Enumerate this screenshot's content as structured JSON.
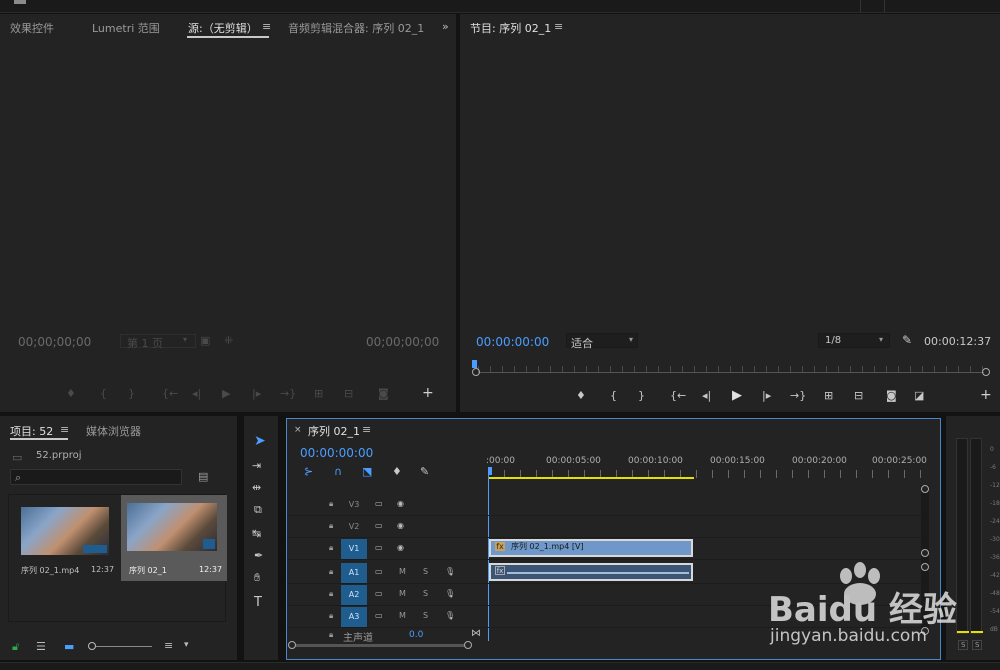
{
  "top_tabs": {
    "effect_controls": "效果控件",
    "lumetri": "Lumetri 范围",
    "source": "源:（无剪辑）",
    "audio_mixer": "音频剪辑混合器: 序列 02_1",
    "program": "节目: 序列 02_1"
  },
  "source_monitor": {
    "timecode_left": "00;00;00;00",
    "page": "第 1 页",
    "timecode_right": "00;00;00;00"
  },
  "program_monitor": {
    "timecode": "00:00:00:00",
    "fit": "适合",
    "resolution": "1/8",
    "duration": "00:00:12:37"
  },
  "project": {
    "tab": "项目: 52",
    "media_browser": "媒体浏览器",
    "file": "52.prproj",
    "items": [
      {
        "name": "序列 02_1.mp4",
        "duration": "12:37"
      },
      {
        "name": "序列 02_1",
        "duration": "12:37"
      }
    ]
  },
  "timeline": {
    "tab": "序列 02_1",
    "timecode": "00:00:00:00",
    "ruler": [
      ":00:00",
      "00:00:05:00",
      "00:00:10:00",
      "00:00:15:00",
      "00:00:20:00",
      "00:00:25:00"
    ],
    "tracks": {
      "v3": "V3",
      "v2": "V2",
      "v1": "V1",
      "a1": "A1",
      "a2": "A2",
      "a3": "A3",
      "m": "M",
      "s": "S",
      "master": "主声道",
      "master_val": "0.0"
    },
    "clip_video": "序列 02_1.mp4 [V]"
  },
  "meter": {
    "labels": [
      "0",
      "-6",
      "-12",
      "-18",
      "-24",
      "-30",
      "-36",
      "-42",
      "-48",
      "-54",
      "dB"
    ],
    "solo": "S"
  },
  "watermark": {
    "line1": "Baidu 经验",
    "line2": "jingyan.baidu.com"
  },
  "colors": {
    "accent": "#4a9eff",
    "track_on": "#1e5d8e",
    "clip": "#6f97c9",
    "work_area": "#e5e000"
  }
}
